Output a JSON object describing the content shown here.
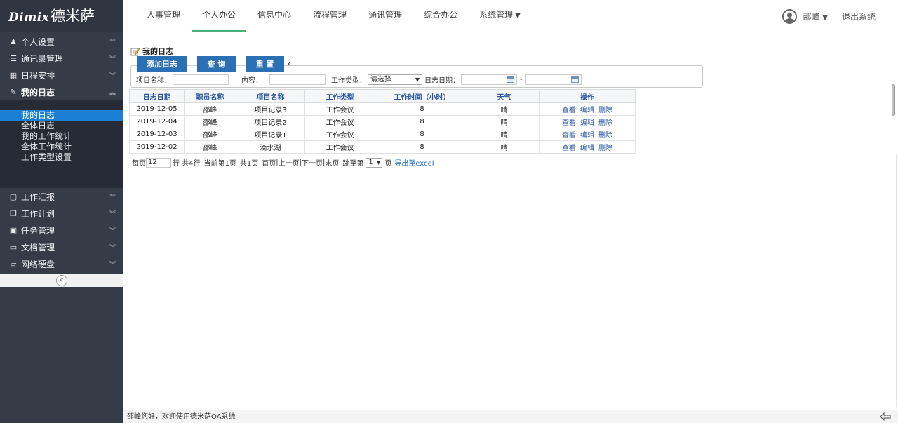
{
  "brand": {
    "latin": "Dimix",
    "cn": "德米萨"
  },
  "nav": {
    "items": [
      "人事管理",
      "个人办公",
      "信息中心",
      "流程管理",
      "通讯管理",
      "综合办公",
      "系统管理"
    ],
    "active_index": 1,
    "user": "邵峰",
    "logout": "退出系统"
  },
  "sidebar": {
    "groups_top": [
      {
        "label": "个人设置",
        "icon": "user-icon"
      },
      {
        "label": "通讯录管理",
        "icon": "list-icon"
      },
      {
        "label": "日程安排",
        "icon": "calendar-icon"
      },
      {
        "label": "我的日志",
        "icon": "pencil-icon",
        "expanded": true
      }
    ],
    "sub_items": [
      "我的日志",
      "全体日志",
      "我的工作统计",
      "全体工作统计",
      "工作类型设置"
    ],
    "sub_active": 0,
    "groups_bottom": [
      {
        "label": "工作汇报",
        "icon": "document-icon"
      },
      {
        "label": "工作计划",
        "icon": "copy-icon"
      },
      {
        "label": "任务管理",
        "icon": "clipboard-icon"
      },
      {
        "label": "文档管理",
        "icon": "folder-icon"
      },
      {
        "label": "网络硬盘",
        "icon": "folder-open-icon"
      }
    ]
  },
  "page": {
    "title": "我的日志",
    "buttons": {
      "add": "添加日志",
      "query": "查 询",
      "reset": "重 置"
    },
    "filters": {
      "project_label": "项目名称：",
      "content_label": "内容：",
      "type_label": "工作类型：",
      "type_value": "请选择",
      "date_label": "日志日期：",
      "date_sep": "-"
    },
    "table": {
      "headers": [
        "日志日期",
        "职员名称",
        "项目名称",
        "工作类型",
        "工作时间（小时）",
        "天气",
        "操作"
      ],
      "rows": [
        [
          "2019-12-05",
          "邵峰",
          "项目记录3",
          "工作会议",
          "8",
          "晴"
        ],
        [
          "2019-12-04",
          "邵峰",
          "项目记录2",
          "工作会议",
          "8",
          "晴"
        ],
        [
          "2019-12-03",
          "邵峰",
          "项目记录1",
          "工作会议",
          "8",
          "晴"
        ],
        [
          "2019-12-02",
          "邵峰",
          "滴水湖",
          "工作会议",
          "8",
          "晴"
        ]
      ],
      "actions": [
        "查看",
        "编辑",
        "删除"
      ]
    },
    "pager": {
      "per_page_label": "每页",
      "per_page_value": "12",
      "rows_total": "行 共4行",
      "current_page": "当前第1页",
      "total_pages": "共1页",
      "first": "首页",
      "prev": "上一页",
      "next": "下一页",
      "last": "末页",
      "jump_label": "跳至第",
      "jump_value": "1",
      "page_suffix": "页",
      "export": "导出至excel"
    }
  },
  "footer": {
    "text": "邵峰您好，欢迎使用德米萨OA系统"
  },
  "colors": {
    "sidebar": "#353b47",
    "sidebar_active": "#1c7fd6",
    "button": "#2b6fb5",
    "nav_active": "#4caf7d",
    "header_text": "#2a58a0"
  }
}
